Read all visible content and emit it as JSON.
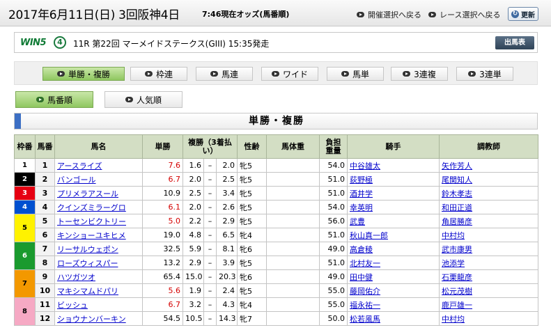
{
  "header": {
    "date_title": "2017年6月11日(日) 3回阪神4日",
    "odds_time": "7:46現在オッズ(馬番順)",
    "link_meeting": "開催選択へ戻る",
    "link_race": "レース選択へ戻る",
    "refresh_label": "更新"
  },
  "race": {
    "win5_logo": "WIN5",
    "leg_number": "4",
    "race_info": "11R 第22回 マーメイドステークス(GIII) 15:35発走",
    "shutuba_label": "出馬表"
  },
  "tabs": [
    "単勝・複勝",
    "枠連",
    "馬連",
    "ワイド",
    "馬単",
    "3連複",
    "3連単"
  ],
  "sort_tabs": [
    "馬番順",
    "人気順"
  ],
  "section_title": "単勝・複勝",
  "columns": {
    "waku": "枠番",
    "umaban": "馬番",
    "horse": "馬名",
    "win": "単勝",
    "place": "複勝（3着払い）",
    "sexage": "性齢",
    "bodyweight": "馬体重",
    "burden": "負担重量",
    "jockey": "騎手",
    "trainer": "調教師"
  },
  "rows": [
    {
      "waku": "1",
      "umaban": "1",
      "horse": "アースライズ",
      "win": "7.6",
      "place_min": "1.6",
      "place_max": "2.0",
      "sexage": "牝5",
      "burden": "54.0",
      "jockey": "中谷雄太",
      "trainer": "矢作芳人"
    },
    {
      "waku": "2",
      "umaban": "2",
      "horse": "バンゴール",
      "win": "6.7",
      "place_min": "2.0",
      "place_max": "2.5",
      "sexage": "牝5",
      "burden": "51.0",
      "jockey": "荻野極",
      "trainer": "尾関知人"
    },
    {
      "waku": "3",
      "umaban": "3",
      "horse": "プリメラアスール",
      "win": "10.9",
      "place_min": "2.5",
      "place_max": "3.4",
      "sexage": "牝5",
      "burden": "51.0",
      "jockey": "酒井学",
      "trainer": "鈴木孝志"
    },
    {
      "waku": "4",
      "umaban": "4",
      "horse": "クインズミラーグロ",
      "win": "6.1",
      "place_min": "2.0",
      "place_max": "2.6",
      "sexage": "牝5",
      "burden": "54.0",
      "jockey": "幸英明",
      "trainer": "和田正道"
    },
    {
      "waku": "5",
      "umaban": "5",
      "horse": "トーセンビクトリー",
      "win": "5.0",
      "place_min": "2.2",
      "place_max": "2.9",
      "sexage": "牝5",
      "burden": "56.0",
      "jockey": "武豊",
      "trainer": "角居勝彦"
    },
    {
      "waku": "",
      "umaban": "6",
      "horse": "キンショーユキヒメ",
      "win": "19.0",
      "place_min": "4.8",
      "place_max": "6.5",
      "sexage": "牝4",
      "burden": "51.0",
      "jockey": "秋山真一郎",
      "trainer": "中村均"
    },
    {
      "waku": "6",
      "umaban": "7",
      "horse": "リーサルウェポン",
      "win": "32.5",
      "place_min": "5.9",
      "place_max": "8.1",
      "sexage": "牝6",
      "burden": "49.0",
      "jockey": "高倉稜",
      "trainer": "武市康男"
    },
    {
      "waku": "",
      "umaban": "8",
      "horse": "ローズウィスパー",
      "win": "13.2",
      "place_min": "2.9",
      "place_max": "3.9",
      "sexage": "牝5",
      "burden": "51.0",
      "jockey": "北村友一",
      "trainer": "池添学"
    },
    {
      "waku": "7",
      "umaban": "9",
      "horse": "ハツガツオ",
      "win": "65.4",
      "place_min": "15.0",
      "place_max": "20.3",
      "sexage": "牝6",
      "burden": "49.0",
      "jockey": "田中健",
      "trainer": "石栗龍彦"
    },
    {
      "waku": "",
      "umaban": "10",
      "horse": "マキシマムドパリ",
      "win": "5.6",
      "place_min": "1.9",
      "place_max": "2.4",
      "sexage": "牝5",
      "burden": "55.0",
      "jockey": "藤岡佑介",
      "trainer": "松元茂樹"
    },
    {
      "waku": "8",
      "umaban": "11",
      "horse": "ビッシュ",
      "win": "6.7",
      "place_min": "3.2",
      "place_max": "4.3",
      "sexage": "牝4",
      "burden": "55.0",
      "jockey": "福永祐一",
      "trainer": "鹿戸雄一"
    },
    {
      "waku": "",
      "umaban": "12",
      "horse": "ショウナンバーキン",
      "win": "54.5",
      "place_min": "10.5",
      "place_max": "14.3",
      "sexage": "牝7",
      "burden": "50.0",
      "jockey": "松若風馬",
      "trainer": "中村均"
    }
  ],
  "colors": {
    "waku_1": "#ffffff",
    "waku_2": "#000000",
    "waku_3": "#e60012",
    "waku_4": "#0050d0",
    "waku_5": "#fff200",
    "waku_6": "#1a9a2e",
    "waku_7": "#f39800",
    "waku_8": "#f6a9c4",
    "popular_win_text": "#d40000",
    "active_tab": "#9fd070",
    "header_cell": "#d3dec4"
  }
}
